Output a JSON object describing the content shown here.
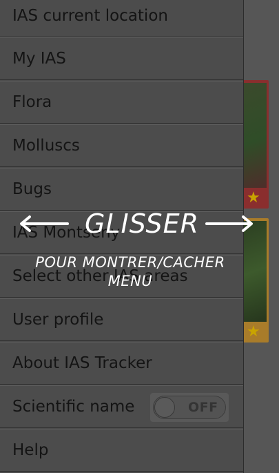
{
  "menu": {
    "items": [
      {
        "label": "IAS current location"
      },
      {
        "label": "My IAS"
      },
      {
        "label": "Flora"
      },
      {
        "label": "Molluscs"
      },
      {
        "label": "Bugs"
      },
      {
        "label": "IAS Montseny"
      },
      {
        "label": "Select other IAS areas"
      },
      {
        "label": "User profile"
      },
      {
        "label": "About IAS Tracker"
      },
      {
        "label": "Scientific name"
      },
      {
        "label": "Help"
      }
    ],
    "scientific_toggle_state": "OFF"
  },
  "hint": {
    "title": "GLISSER",
    "line1": "POUR MONTRER/CACHER",
    "line2": "MENU"
  },
  "colors": {
    "overlay_text": "#ffffff",
    "star": "#c9a400"
  },
  "icons": [
    "left-arrow-icon",
    "right-arrow-icon",
    "star-icon"
  ]
}
